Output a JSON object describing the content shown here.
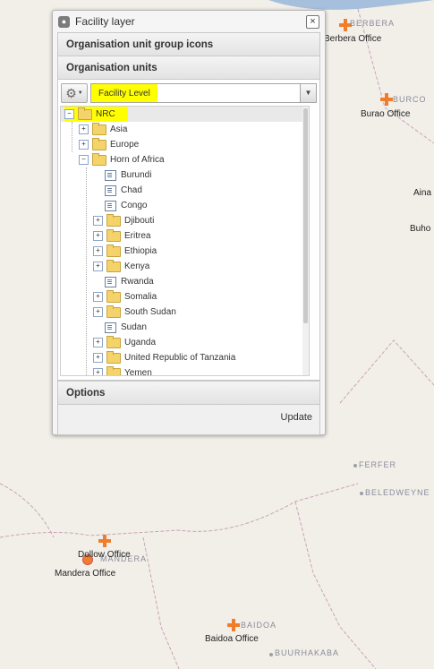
{
  "map": {
    "labels": [
      {
        "text": "Berbera Office"
      },
      {
        "text": "Burao Office"
      },
      {
        "text": "Aina"
      },
      {
        "text": "Buho"
      },
      {
        "text": "Dollow Office"
      },
      {
        "text": "Mandera Office"
      },
      {
        "text": "Baidoa Office"
      }
    ],
    "cities": [
      {
        "text": "BERBERA"
      },
      {
        "text": "BURCO"
      },
      {
        "text": "FERFER"
      },
      {
        "text": "BELEDWEYNE"
      },
      {
        "text": "MANDERA"
      },
      {
        "text": "BAIDOA"
      },
      {
        "text": "BUURHAKABA"
      }
    ]
  },
  "panel": {
    "title": "Facility layer",
    "close": "×",
    "sections": {
      "group_icons": "Organisation unit group icons",
      "org_units": "Organisation units",
      "options": "Options"
    },
    "level_select": {
      "value": "Facility Level"
    },
    "tree": [
      {
        "label": "NRC",
        "depth": 0,
        "type": "folder",
        "toggle": "−",
        "highlight": true
      },
      {
        "label": "Asia",
        "depth": 1,
        "type": "folder",
        "toggle": "+"
      },
      {
        "label": "Europe",
        "depth": 1,
        "type": "folder",
        "toggle": "+"
      },
      {
        "label": "Horn of Africa",
        "depth": 1,
        "type": "folder",
        "toggle": "−"
      },
      {
        "label": "Burundi",
        "depth": 2,
        "type": "leaf"
      },
      {
        "label": "Chad",
        "depth": 2,
        "type": "leaf"
      },
      {
        "label": "Congo",
        "depth": 2,
        "type": "leaf"
      },
      {
        "label": "Djibouti",
        "depth": 2,
        "type": "folder",
        "toggle": "+"
      },
      {
        "label": "Eritrea",
        "depth": 2,
        "type": "folder",
        "toggle": "+"
      },
      {
        "label": "Ethiopia",
        "depth": 2,
        "type": "folder",
        "toggle": "+"
      },
      {
        "label": "Kenya",
        "depth": 2,
        "type": "folder",
        "toggle": "+"
      },
      {
        "label": "Rwanda",
        "depth": 2,
        "type": "leaf"
      },
      {
        "label": "Somalia",
        "depth": 2,
        "type": "folder",
        "toggle": "+"
      },
      {
        "label": "South Sudan",
        "depth": 2,
        "type": "folder",
        "toggle": "+"
      },
      {
        "label": "Sudan",
        "depth": 2,
        "type": "leaf"
      },
      {
        "label": "Uganda",
        "depth": 2,
        "type": "folder",
        "toggle": "+"
      },
      {
        "label": "United Republic of Tanzania",
        "depth": 2,
        "type": "folder",
        "toggle": "+"
      },
      {
        "label": "Yemen",
        "depth": 2,
        "type": "folder",
        "toggle": "+"
      }
    ],
    "update": "Update"
  }
}
